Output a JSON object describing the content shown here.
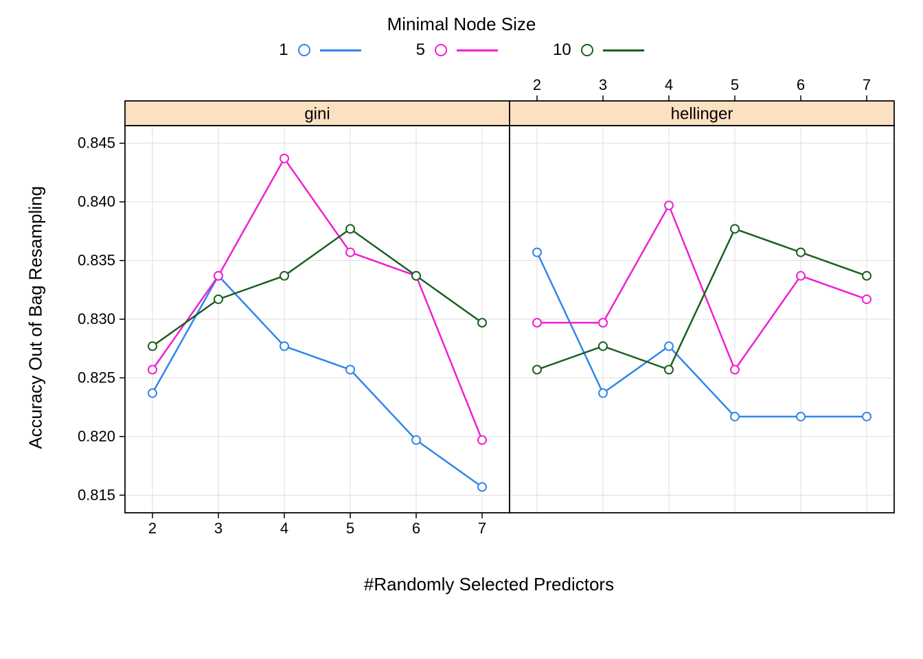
{
  "chart_data": {
    "type": "line",
    "legend_title": "Minimal Node Size",
    "xlabel": "#Randomly Selected Predictors",
    "ylabel": "Accuracy Out of Bag Resampling",
    "x_ticks": [
      2,
      3,
      4,
      5,
      6,
      7
    ],
    "y_ticks": [
      0.815,
      0.82,
      0.825,
      0.83,
      0.835,
      0.84,
      0.845
    ],
    "ylim": [
      0.8135,
      0.8465
    ],
    "panels": [
      {
        "name": "gini",
        "x_axis_position": "bottom",
        "series": [
          {
            "name": "1",
            "color": "#2f86eb",
            "values": [
              0.8237,
              0.8337,
              0.8277,
              0.8257,
              0.8197,
              0.8157
            ]
          },
          {
            "name": "5",
            "color": "#ef1fd3",
            "values": [
              0.8257,
              0.8337,
              0.8437,
              0.8357,
              0.8337,
              0.8197
            ]
          },
          {
            "name": "10",
            "color": "#1b5e20",
            "values": [
              0.8277,
              0.8317,
              0.8337,
              0.8377,
              0.8337,
              0.8297
            ]
          }
        ]
      },
      {
        "name": "hellinger",
        "x_axis_position": "top",
        "series": [
          {
            "name": "1",
            "color": "#2f86eb",
            "values": [
              0.8357,
              0.8237,
              0.8277,
              0.8217,
              0.8217,
              0.8217
            ]
          },
          {
            "name": "5",
            "color": "#ef1fd3",
            "values": [
              0.8297,
              0.8297,
              0.8397,
              0.8257,
              0.8337,
              0.8317
            ]
          },
          {
            "name": "10",
            "color": "#1b5e20",
            "values": [
              0.8257,
              0.8277,
              0.8257,
              0.8377,
              0.8357,
              0.8337
            ]
          }
        ]
      }
    ],
    "series_colors": {
      "1": "#2f86eb",
      "5": "#ef1fd3",
      "10": "#1b5e20"
    },
    "legend_entries": [
      "1",
      "5",
      "10"
    ]
  }
}
